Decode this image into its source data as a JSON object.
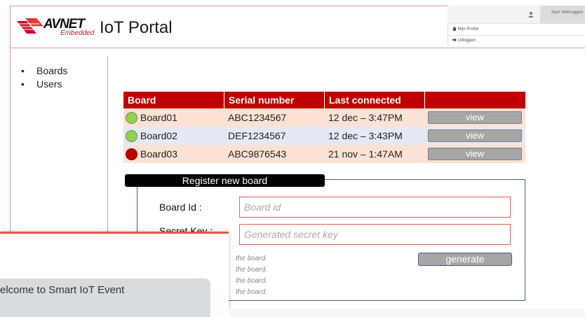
{
  "header": {
    "logo_text": "AVNET",
    "logo_subtext": "Embedded",
    "title": "IoT Portal"
  },
  "user_menu": {
    "user_icon": "user-icon",
    "user_name": "Sam Verbruggen",
    "items": [
      {
        "icon": "home-icon",
        "label": "Mijn Profiel"
      },
      {
        "icon": "logout-icon",
        "label": "Uitloggen"
      }
    ]
  },
  "nav": {
    "items": [
      {
        "label": "Boards"
      },
      {
        "label": "Users"
      }
    ]
  },
  "boards_table": {
    "columns": [
      "Board",
      "Serial number",
      "Last connected",
      ""
    ],
    "rows": [
      {
        "status": "online",
        "status_color": "#92d050",
        "board": "Board01",
        "serial": "ABC1234567",
        "last_connected": "12 dec – 3:47PM",
        "action": "view"
      },
      {
        "status": "online",
        "status_color": "#92d050",
        "board": "Board02",
        "serial": "DEF1234567",
        "last_connected": "12 dec – 3:43PM",
        "action": "view"
      },
      {
        "status": "offline",
        "status_color": "#c00000",
        "board": "Board03",
        "serial": "ABC9876543",
        "last_connected": "21 nov – 1:47AM",
        "action": "view"
      }
    ]
  },
  "register": {
    "title": "Register new board",
    "board_id_label": "Board Id :",
    "board_id_placeholder": "Board id",
    "secret_key_label": "Secret Key :",
    "secret_key_placeholder": "Generated secret key",
    "generate_label": "generate",
    "hints": [
      "the board.",
      "the board.",
      "the board.",
      "the board."
    ]
  },
  "popup": {
    "message": "elcome to Smart IoT Event"
  },
  "colors": {
    "brand_red": "#c00000",
    "online": "#92d050",
    "offline": "#c00000",
    "panel_border": "#4a5f86"
  }
}
